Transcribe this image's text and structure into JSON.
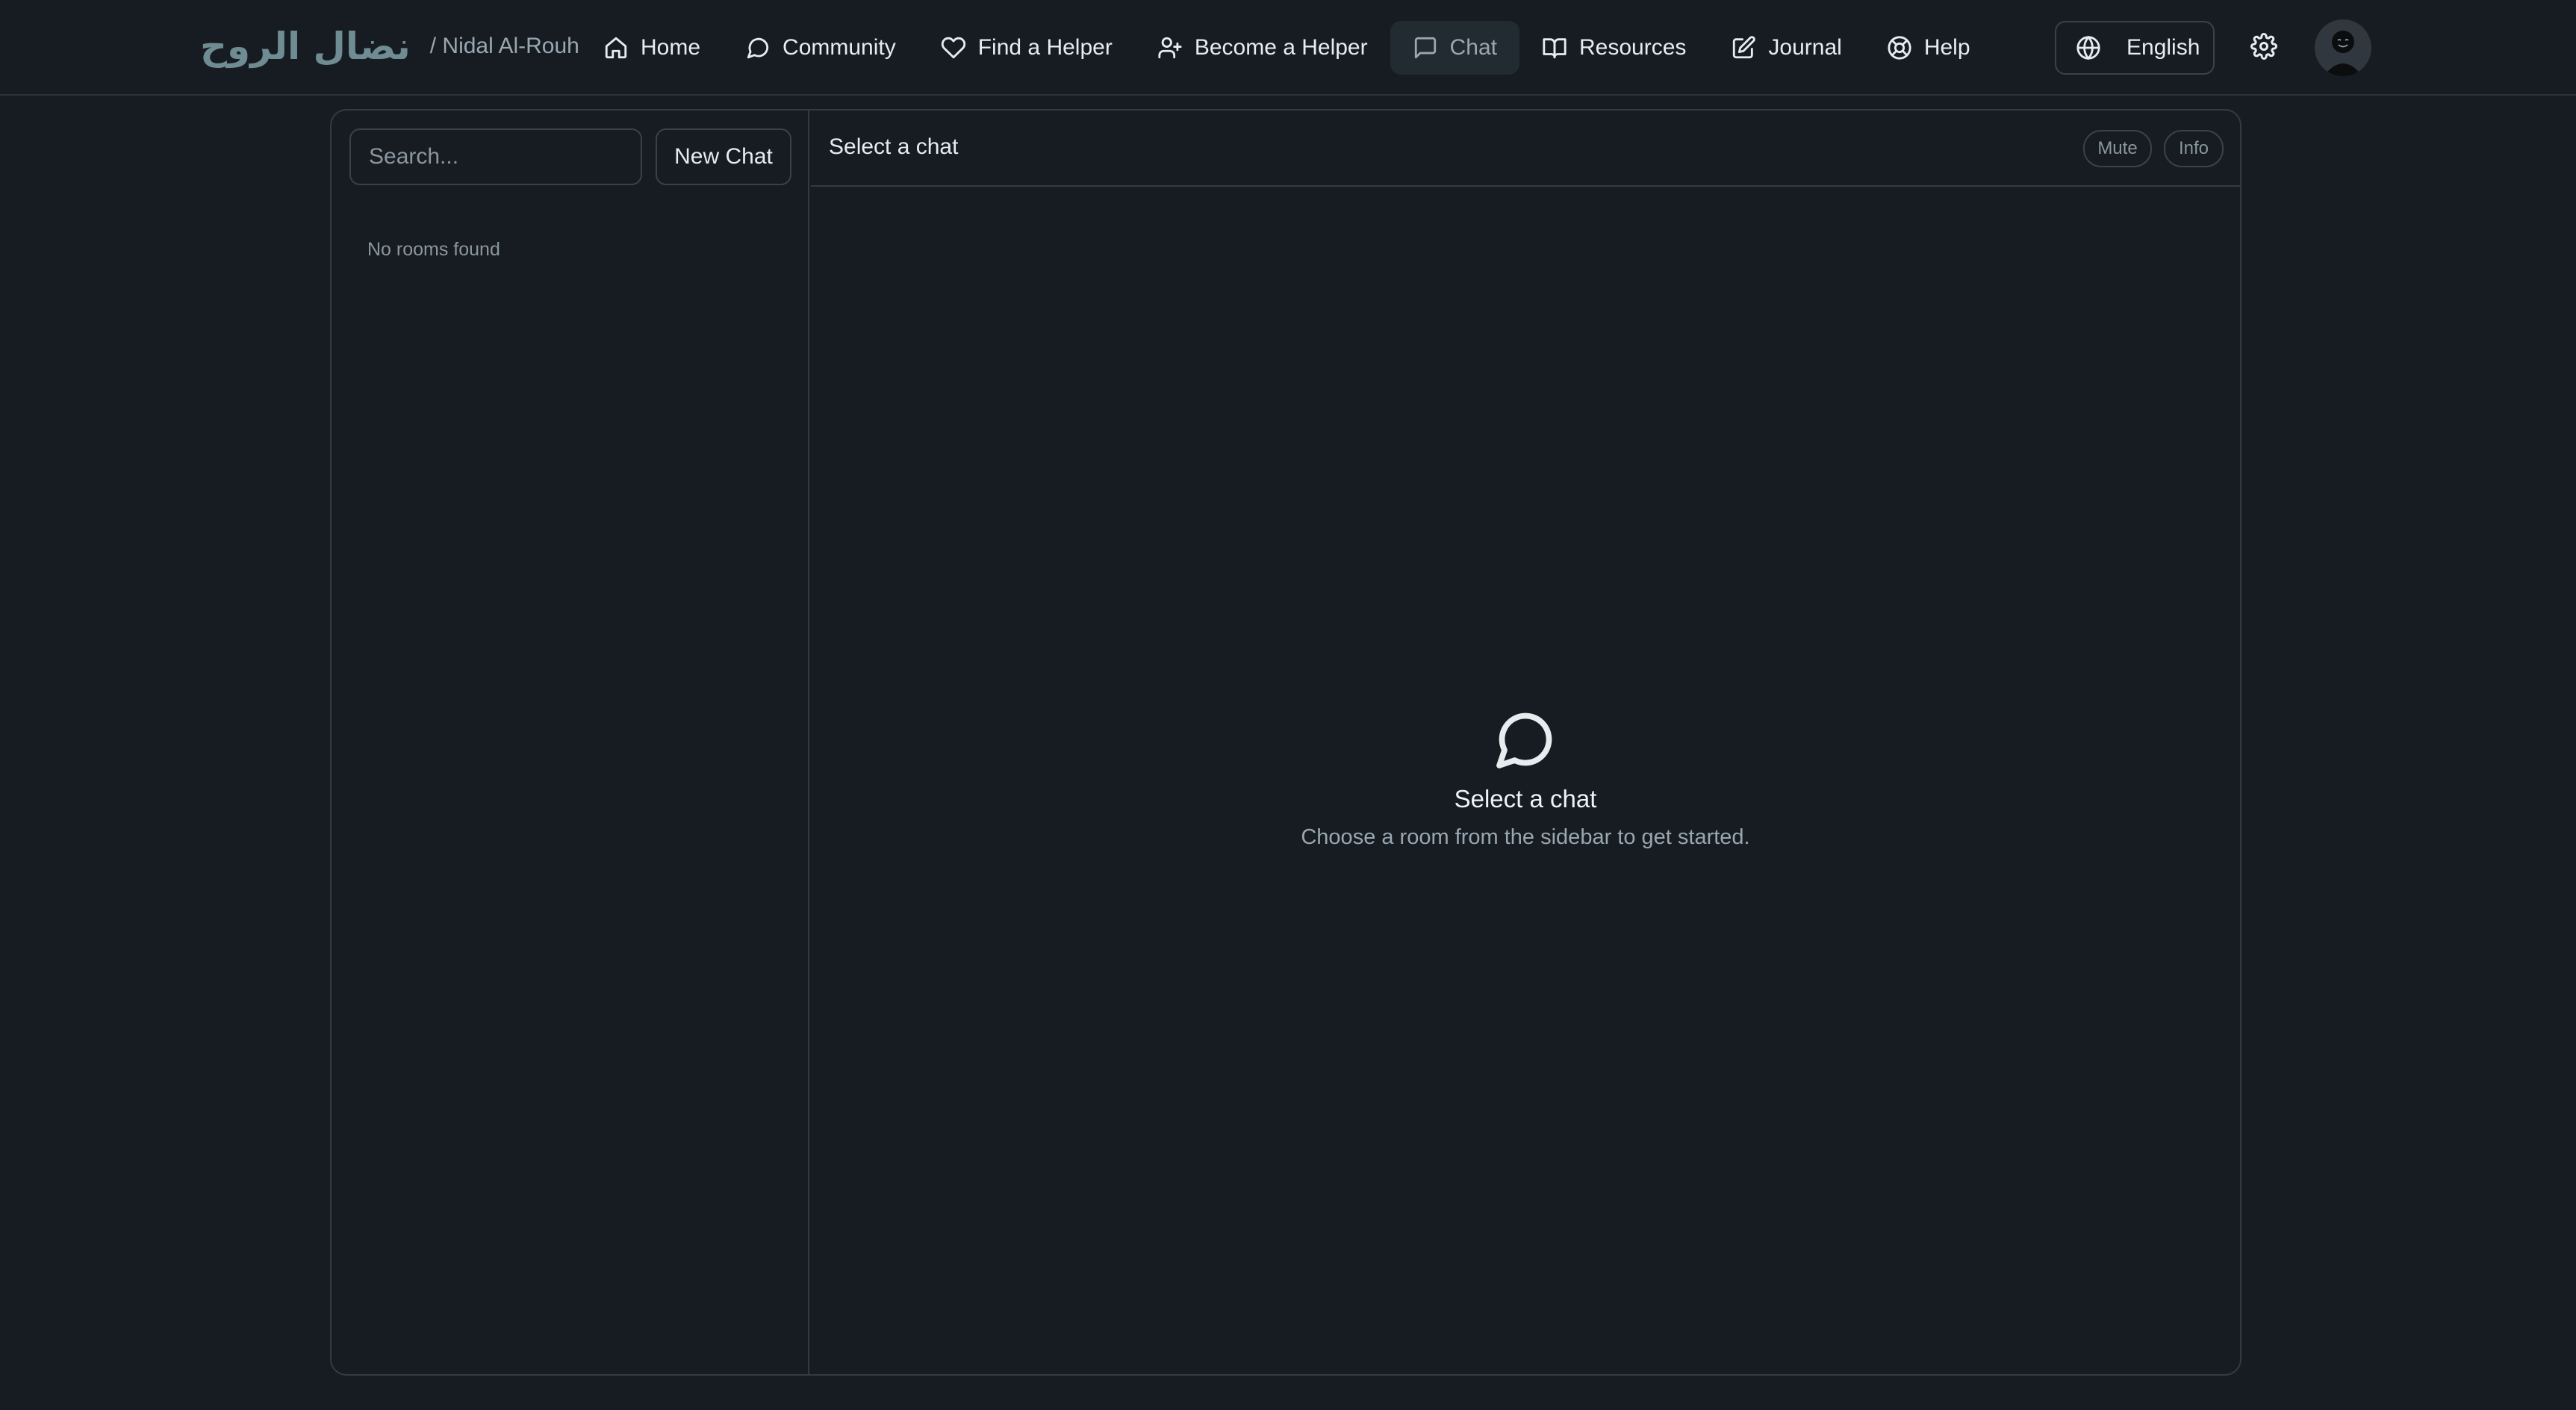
{
  "brand": {
    "arabic_name": "نضال الروح",
    "subtitle": "/ Nidal Al-Rouh"
  },
  "nav": {
    "items": [
      {
        "label": "Home",
        "icon": "home-icon"
      },
      {
        "label": "Community",
        "icon": "message-circle-icon"
      },
      {
        "label": "Find a Helper",
        "icon": "heart-icon"
      },
      {
        "label": "Become a Helper",
        "icon": "user-plus-icon"
      },
      {
        "label": "Chat",
        "icon": "message-square-icon",
        "active": true
      },
      {
        "label": "Resources",
        "icon": "book-open-icon"
      },
      {
        "label": "Journal",
        "icon": "edit-icon"
      },
      {
        "label": "Help",
        "icon": "life-buoy-icon"
      }
    ]
  },
  "language": {
    "label": "English",
    "icon": "globe-icon"
  },
  "settings": {
    "icon": "gear-icon"
  },
  "sidebar": {
    "search_placeholder": "Search...",
    "search_value": "",
    "new_chat_label": "New Chat",
    "empty_text": "No rooms found"
  },
  "chat": {
    "header_title": "Select a chat",
    "mute_label": "Mute",
    "info_label": "Info",
    "empty_title": "Select a chat",
    "empty_subtitle": "Choose a room from the sidebar to get started."
  },
  "colors": {
    "background": "#161c22",
    "border": "#323b44",
    "active_nav_bg": "#222a32",
    "brand_teal": "#6f8c92",
    "muted_text": "#9aa7b1"
  }
}
